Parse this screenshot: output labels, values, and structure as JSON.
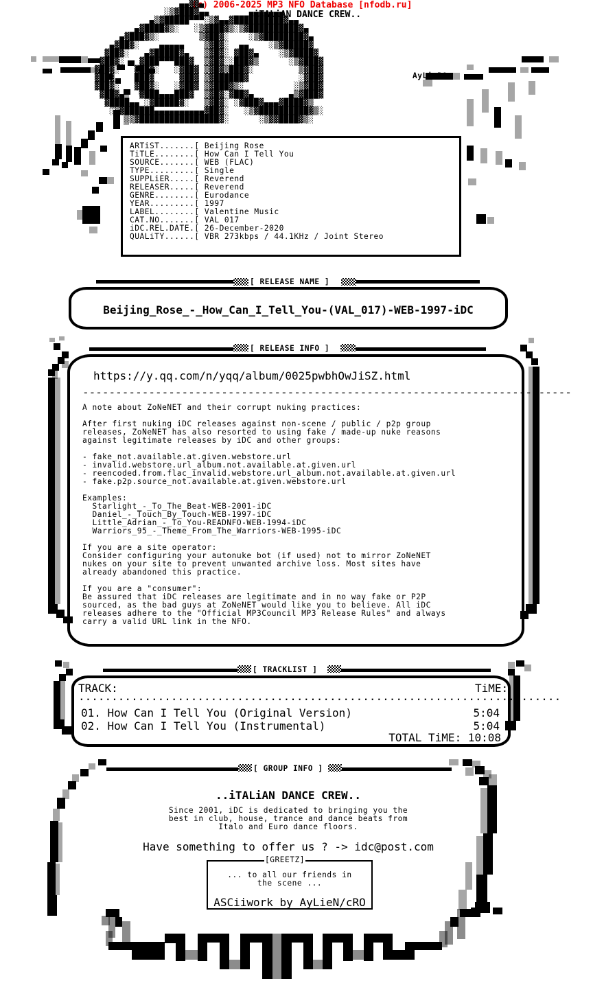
{
  "header": {
    "database_line": "(c) 2006-2025 MP3 NFO Database [nfodb.ru]",
    "crew_tagline": "..iTALiAN DANCE CREW..",
    "accent_color": "#ee0000",
    "text_color": "#000000",
    "background_color": "#ffffff"
  },
  "logo": {
    "name": "iDC",
    "artist_signature": "AyLicRO",
    "art": [
      "                                    ▄▄▓▓▄                                      ",
      "                                 ░▒▓███▓▄▄        ▄▄▄▄▄▄▄                      ",
      "                              ▄▒▓█████▀▀▀░▒▓▄▄▓██████████▓▄▄                   ",
      "                           ▄▓████▓▒░   ░▒▓███▓▒░▒▓██████████▓▄                 ",
      "                        ▄▓███▓▒░        ▒▓██▓░    ░▒▓████████▓▄                ",
      "                      ▄▓██▓░    ▄▄▄▄▄    ▒▓█▓░  ▄▄    ░▒▓█████▓               ",
      "                     ▓██▓░   ▄▓█████▓▄   ▒▓█▓░ ▓██▓▄    ░▒▓████▓              ",
      "                    ▓██▓░   ▓███▀▀▀███▓  ▒▓█▓░░███▓▒      ░▒▓███▓             ",
      "                   ▓██▓░   ▓██▓░   ░▓██▓ ▒▓█▓▒███▓░         ▒▓██▓             ",
      "                   ▓██▓    ███▓     ▓██▓ ▒▓██████▓          ░▓██▓             ",
      "                   ▓██▓░   ▓██▓░   ░▓██▓ ▒▓███▓▒░          ░▒▓██▓             ",
      "                    ▓██▓▄   ▓███▄▄▄███▓  ▒▓█▓░▓██▓▄       ▄▒▓███▓             ",
      "                     ▓████▄▄ ░▓█████▓░   ▒▓█▓░ ░▓███▓▄▄▄▓████▓▒              ",
      "                      ░▒▓██████▄▄▄▄▄▄▄▄▄▄▓██▓░   ░▒▓██████████▓▒░             ",
      "                         ░▒▓████████████████▓░      ░▒▓▓████▓▒░               "
    ]
  },
  "metadata": {
    "label": "release-metadata",
    "fields": [
      {
        "key": "ARTiST.......[",
        "value": "Beijing Rose"
      },
      {
        "key": "TiTLE........[",
        "value": "How Can I Tell You"
      },
      {
        "key": "SOURCE.......[",
        "value": "WEB (FLAC)"
      },
      {
        "key": "TYPE.........[",
        "value": "Single"
      },
      {
        "key": "SUPPLiER.....[",
        "value": "Reverend"
      },
      {
        "key": "RELEASER.....[",
        "value": "Reverend"
      },
      {
        "key": "GENRE........[",
        "value": "Eurodance"
      },
      {
        "key": "YEAR.........[",
        "value": "1997"
      },
      {
        "key": "LABEL........[",
        "value": "Valentine Music"
      },
      {
        "key": "CAT.NO.......[",
        "value": "VAL 017"
      },
      {
        "key": "iDC.REL.DATE.[",
        "value": "26-December-2020"
      },
      {
        "key": "QUALiTY......[",
        "value": "VBR 273kbps / 44.1KHz / Joint Stereo"
      }
    ]
  },
  "release_name": {
    "title": "[ RELEASE NAME ]",
    "value": "Beijing_Rose_-_How_Can_I_Tell_You-(VAL_017)-WEB-1997-iDC"
  },
  "release_info": {
    "title": "[ RELEASE INFO ]",
    "url": "https://y.qq.com/n/yqq/album/0025pwbhOwJiSZ.html",
    "divider": "--------------------------------------------------------------------------",
    "paragraphs": [
      "A note about ZoNeNET and their corrupt nuking practices:",
      "",
      "After first nuking iDC releases against non-scene / public / p2p group",
      "releases, ZoNeNET has also resorted to using fake / made-up nuke reasons",
      "against legitimate releases by iDC and other groups:",
      "",
      "- fake_not.available.at.given.webstore.url",
      "- invalid.webstore.url_album.not.available.at.given.url",
      "- reencoded.from.flac_invalid.webstore.url_album.not.available.at.given.url",
      "- fake.p2p.source_not.available.at.given.webstore.url",
      "",
      "Examples:",
      "  Starlight_-_To_The_Beat-WEB-2001-iDC",
      "  Daniel_-_Touch_By_Touch-WEB-1997-iDC",
      "  Little_Adrian_-_To_You-READNFO-WEB-1994-iDC",
      "  Warriors_95_-_Theme_From_The_Warriors-WEB-1995-iDC",
      "",
      "If you are a site operator:",
      "Consider configuring your autonuke bot (if used) not to mirror ZoNeNET",
      "nukes on your site to prevent unwanted archive loss. Most sites have",
      "already abandoned this practice.",
      "",
      "If you are a \"consumer\":",
      "Be assured that iDC releases are legitimate and in no way fake or P2P",
      "sourced, as the bad guys at ZoNeNET would like you to believe. All iDC",
      "releases adhere to the \"Official MP3Council MP3 Release Rules\" and always",
      "carry a valid URL link in the NFO."
    ]
  },
  "tracklist": {
    "title": "[ TRACKLIST ]",
    "column_track": "TRACK:",
    "column_time": "TiME:",
    "separator": ".........................................................................",
    "tracks": [
      {
        "no": "01.",
        "name": "How Can I Tell You (Original Version)",
        "time": "5:04"
      },
      {
        "no": "02.",
        "name": "How Can I Tell You (Instrumental)",
        "time": "5:04"
      }
    ],
    "total_label": "TOTAL TiME:",
    "total_time": "10:08"
  },
  "group_info": {
    "title": "[ GROUP INFO ]",
    "crew_tagline": "..iTALiAN DANCE CREW..",
    "description": [
      "Since 2001, iDC is dedicated to bringing you the",
      "best in club, house, trance and dance beats from",
      "Italo and Euro dance floors."
    ],
    "contact_line": "Have something to offer us ? -> idc@post.com",
    "greetz": {
      "label": "[GREETZ]",
      "lines": [
        "... to all our friends in",
        "the scene ..."
      ],
      "credit": "ASCiiwork by AyLieN/cRO"
    }
  },
  "footer_art": {
    "name": "bottom-border-decoration"
  }
}
